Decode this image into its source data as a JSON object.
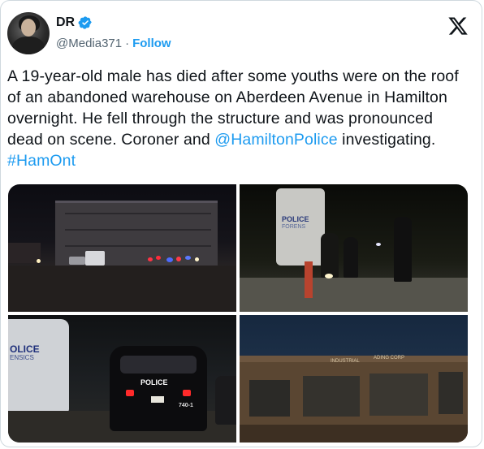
{
  "author": {
    "name": "DR",
    "handle": "@Media371",
    "separator": "·",
    "follow_label": "Follow"
  },
  "tweet": {
    "text_1": "A 19-year-old male has died after some youths were on the roof of an abandoned warehouse on Aberdeen Avenue in Hamilton overnight. He fell through the structure and was pronounced dead on scene. Coroner and ",
    "mention": "@HamiltonPolice",
    "text_2": " investigating.  ",
    "hashtag": "#HamOnt"
  },
  "media": {
    "photo_2_van_label": "POLICE",
    "photo_2_van_sub": "FORENS",
    "photo_3_van_label": "OLICE",
    "photo_3_van_sub": "ENSICS",
    "photo_3_car_label": "POLICE",
    "photo_3_unit": "740-1",
    "photo_4_sign": "INDUSTRIAL",
    "photo_4_sign_2": "ADING CORP"
  },
  "colors": {
    "link": "#1d9bf0",
    "text": "#0f1419",
    "secondary": "#536471",
    "border": "#cfd9de"
  },
  "icons": [
    "verified-badge-icon",
    "x-logo-icon"
  ]
}
